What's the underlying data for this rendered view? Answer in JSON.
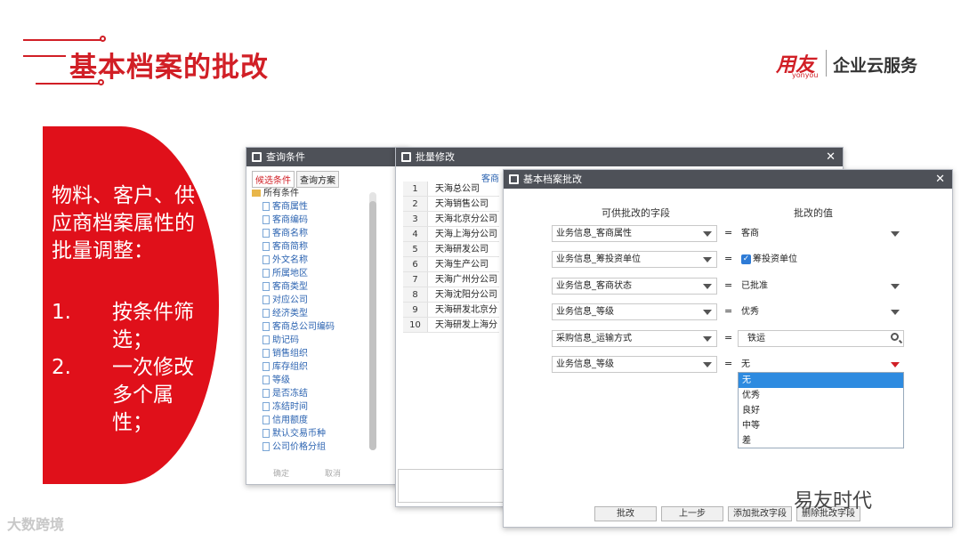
{
  "slide": {
    "title": "基本档案的批改",
    "brand_logo": "用友",
    "brand_logo_sub": "yonyou",
    "brand_tagline": "企业云服务"
  },
  "side_panel": {
    "intro": "物料、客户、供应商档案属性的批量调整：",
    "items": [
      {
        "num": "1.",
        "text": "按条件筛选；"
      },
      {
        "num": "2.",
        "text": "一次修改多个属性；"
      }
    ]
  },
  "query_window": {
    "title": "查询条件",
    "tabs": [
      "候选条件",
      "查询方案"
    ],
    "tree_root": "所有条件",
    "tree_items": [
      "客商属性",
      "客商编码",
      "客商名称",
      "客商简称",
      "外文名称",
      "所属地区",
      "客商类型",
      "对应公司",
      "经济类型",
      "客商总公司编码",
      "助记码",
      "销售组织",
      "库存组织",
      "等级",
      "是否冻结",
      "冻结时间",
      "信用额度",
      "默认交易币种",
      "公司价格分组"
    ],
    "bottom_faint": [
      "确定",
      "取消"
    ]
  },
  "batch_window": {
    "title": "批量修改",
    "header_col": "客商",
    "rows": [
      {
        "n": "1",
        "name": "天海总公司"
      },
      {
        "n": "2",
        "name": "天海销售公司"
      },
      {
        "n": "3",
        "name": "天海北京分公司"
      },
      {
        "n": "4",
        "name": "天海上海分公司"
      },
      {
        "n": "5",
        "name": "天海研发公司"
      },
      {
        "n": "6",
        "name": "天海生产公司"
      },
      {
        "n": "7",
        "name": "天海广州分公司"
      },
      {
        "n": "8",
        "name": "天海沈阳分公司"
      },
      {
        "n": "9",
        "name": "天海研发北京分"
      },
      {
        "n": "10",
        "name": "天海研发上海分"
      }
    ]
  },
  "dialog": {
    "title": "基本档案批改",
    "col_field": "可供批改的字段",
    "col_value": "批改的值",
    "rows": [
      {
        "field": "业务信息_客商属性",
        "value": "客商"
      },
      {
        "field": "业务信息_筹投资单位",
        "value": "筹投资单位",
        "checked": true
      },
      {
        "field": "业务信息_客商状态",
        "value": "已批准"
      },
      {
        "field": "业务信息_等级",
        "value": "优秀"
      },
      {
        "field": "采购信息_运输方式",
        "value": "铁运"
      },
      {
        "field": "业务信息_等级",
        "value": "无"
      }
    ],
    "eq": "=",
    "dropdown_options": [
      "无",
      "优秀",
      "良好",
      "中等",
      "差"
    ],
    "dropdown_selected": "无",
    "buttons": [
      "批改",
      "上一步",
      "添加批改字段",
      "删除批改字段"
    ]
  },
  "watermarks": {
    "left": "大数跨境",
    "right": "易友时代"
  },
  "colors": {
    "accent": "#d11f26",
    "titlebar": "#4e5158",
    "selection": "#2e8be0"
  }
}
